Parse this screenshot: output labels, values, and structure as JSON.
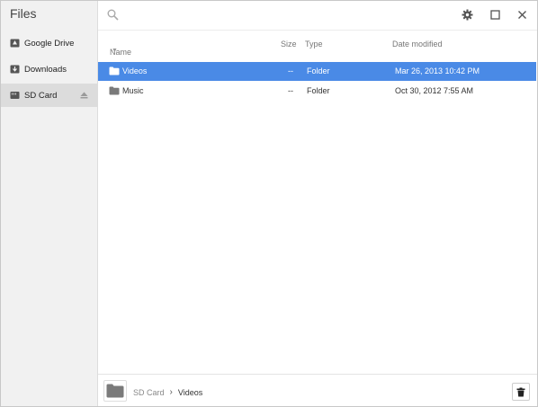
{
  "app": {
    "title": "Files"
  },
  "sidebar": {
    "items": [
      {
        "label": "Google Drive",
        "icon": "google-drive-icon"
      },
      {
        "label": "Downloads",
        "icon": "downloads-icon"
      },
      {
        "label": "SD Card",
        "icon": "sd-card-icon",
        "active": true,
        "eject_icon": "eject-icon"
      }
    ]
  },
  "toolbar": {
    "icons": [
      "search-icon",
      "gear-icon",
      "maximize-icon",
      "close-icon"
    ]
  },
  "columns": {
    "name": "Name",
    "size": "Size",
    "type": "Type",
    "date": "Date modified"
  },
  "files": [
    {
      "name": "Videos",
      "size": "--",
      "type": "Folder",
      "date": "Mar 26, 2013 10:42 PM",
      "selected": true
    },
    {
      "name": "Music",
      "size": "--",
      "type": "Folder",
      "date": "Oct 30, 2012 7:55 AM",
      "selected": false
    }
  ],
  "breadcrumb": {
    "root": "SD Card",
    "separator": "›",
    "current": "Videos"
  },
  "colors": {
    "selection": "#4a8ae6",
    "sidebar_bg": "#f1f1f1",
    "sidebar_active": "#dcdcdc",
    "folder_icon": "#7a7a7a"
  }
}
